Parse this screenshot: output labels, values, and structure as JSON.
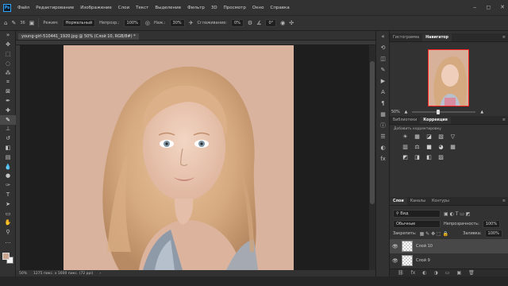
{
  "menubar": {
    "logo": "Ps",
    "items": [
      "Файл",
      "Редактирование",
      "Изображение",
      "Слои",
      "Текст",
      "Выделение",
      "Фильтр",
      "3D",
      "Просмотр",
      "Окно",
      "Справка"
    ],
    "window_controls": [
      "‒",
      "◻",
      "✕"
    ]
  },
  "options": {
    "brush_size": "36",
    "mode_label": "Режим:",
    "mode_value": "Нормальный",
    "opacity_label": "Непрозр.:",
    "opacity_value": "100%",
    "flow_label": "Наж.:",
    "flow_value": "30%",
    "smoothing_label": "Сглаживание:",
    "smoothing_value": "0%",
    "angle_value": "0°"
  },
  "document": {
    "tab_title": "young-girl-510441_1920.jpg @ 50% (Слой 10, RGB/8#) *",
    "status_zoom": "50%",
    "status_info": "1275 пикс. x 1600 пикс. (72 ppi)"
  },
  "navigator": {
    "tabs": [
      "Гистограмма",
      "Навигатор"
    ],
    "active_tab": "Навигатор",
    "zoom_value": "50%"
  },
  "adjustments": {
    "tabs": [
      "Библиотеки",
      "Коррекция"
    ],
    "active_tab": "Коррекция",
    "add_label": "Добавить корректировку",
    "icons": [
      "☀",
      "▦",
      "◪",
      "▧",
      "▽",
      "▥",
      "⚖",
      "■",
      "◕",
      "▦",
      "◩",
      "◨",
      "◧",
      "▨"
    ]
  },
  "layers": {
    "tabs": [
      "Слои",
      "Каналы",
      "Контуры"
    ],
    "active_tab": "Слои",
    "filter_label": "Вид",
    "blend_mode": "Обычные",
    "opacity_label": "Непрозрачность:",
    "opacity_value": "100%",
    "lock_label": "Закрепить:",
    "fill_label": "Заливка:",
    "fill_value": "100%",
    "items": [
      {
        "name": "Слой 10",
        "selected": true
      },
      {
        "name": "Слой 9",
        "selected": false
      }
    ],
    "bottom_icons": [
      "⛓",
      "fx",
      "◐",
      "◑",
      "▭",
      "▣",
      "🗑"
    ]
  },
  "colors": {
    "foreground": "#c9a48e",
    "background": "#f4f4f4",
    "accent": "#31a8ff"
  }
}
